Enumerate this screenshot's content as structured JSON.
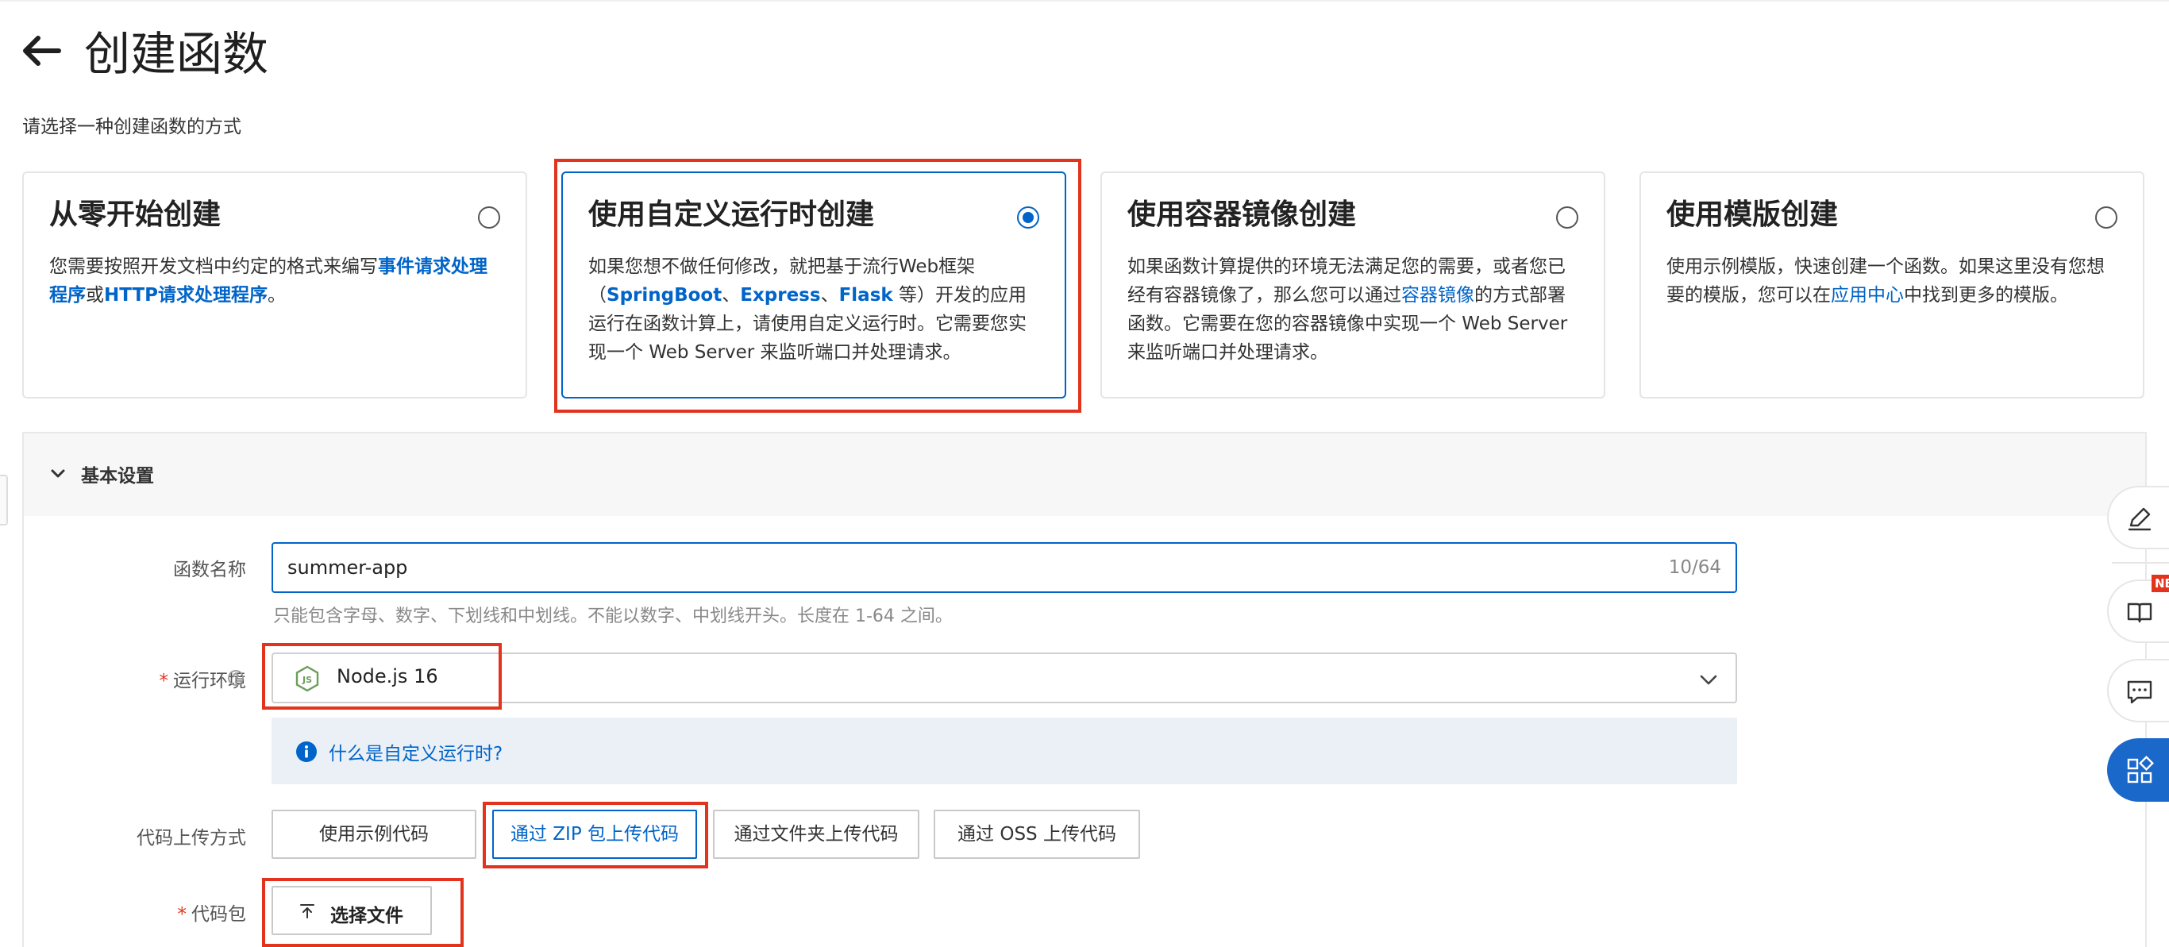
{
  "page": {
    "title": "创建函数",
    "subtitle": "请选择一种创建函数的方式"
  },
  "cards": [
    {
      "title": "从零开始创建",
      "selected": false,
      "desc": {
        "part1": "您需要按照开发文档中约定的格式来编写",
        "link1": "事件请求处理程序",
        "part2": "或",
        "link2": "HTTP请求处理程序",
        "part3": "。"
      }
    },
    {
      "title": "使用自定义运行时创建",
      "selected": true,
      "desc": {
        "part1": "如果您想不做任何修改，就把基于流行Web框架（",
        "link1": "SpringBoot",
        "sep1": "、",
        "link2": "Express",
        "sep2": "、",
        "link3": "Flask",
        "part2": " 等）开发的应用运行在函数计算上，请使用自定义运行时。它需要您实现一个 Web Server 来监听端口并处理请求。"
      }
    },
    {
      "title": "使用容器镜像创建",
      "selected": false,
      "desc": {
        "part1": "如果函数计算提供的环境无法满足您的需要，或者您已经有容器镜像了，那么您可以通过",
        "link1": "容器镜像",
        "part2": "的方式部署函数。它需要在您的容器镜像中实现一个 Web Server 来监听端口并处理请求。"
      }
    },
    {
      "title": "使用模版创建",
      "selected": false,
      "desc": {
        "part1": "使用示例模版，快速创建一个函数。如果这里没有您想要的模版，您可以在",
        "link1": "应用中心",
        "part2": "中找到更多的模版。"
      }
    }
  ],
  "basic_settings": {
    "title": "基本设置",
    "function_name": {
      "label": "函数名称",
      "value": "summer-app",
      "count": "10/64",
      "hint": "只能包含字母、数字、下划线和中划线。不能以数字、中划线开头。长度在 1-64 之间。"
    },
    "runtime": {
      "required_mark": "*",
      "label": "运行环境",
      "value": "Node.js 16",
      "info_link": "什么是自定义运行时?"
    },
    "upload_method": {
      "label": "代码上传方式",
      "options": [
        "使用示例代码",
        "通过 ZIP 包上传代码",
        "通过文件夹上传代码",
        "通过 OSS 上传代码"
      ],
      "selected_index": 1
    },
    "code_package": {
      "required_mark": "*",
      "label": "代码包",
      "button": "选择文件"
    }
  },
  "side_toolbar": {
    "badge": "NEW"
  },
  "colors": {
    "accent": "#0064c8",
    "highlight": "#e2341d",
    "required": "#e2341d"
  }
}
